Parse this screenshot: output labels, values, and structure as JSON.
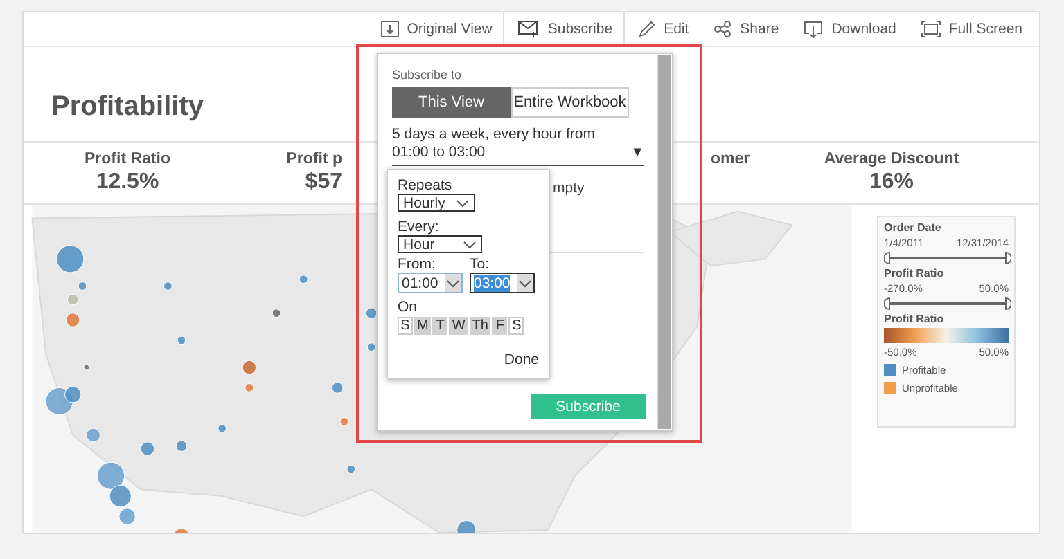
{
  "toolbar": [
    {
      "label": "Original View"
    },
    {
      "label": "Subscribe"
    },
    {
      "label": "Edit"
    },
    {
      "label": "Share"
    },
    {
      "label": "Download"
    },
    {
      "label": "Full Screen"
    }
  ],
  "title": "Profitability",
  "kpis": [
    {
      "label": "Profit Ratio",
      "value": "12.5%"
    },
    {
      "label": "Profit p",
      "value": "$57"
    },
    {
      "label": "omer"
    },
    {
      "label": "Average Discount",
      "value": "16%"
    }
  ],
  "legend": {
    "filters": [
      {
        "title": "Order Date",
        "min": "1/4/2011",
        "max": "12/31/2014",
        "level": 1
      },
      {
        "title": "Profit Ratio",
        "min": "-270.0%",
        "max": "50.0%",
        "level": 1
      }
    ],
    "scale": {
      "title": "Profit Ratio",
      "min": "-50.0%",
      "max": "50.0%"
    },
    "items": [
      {
        "label": "Profitable",
        "color": "#4f8fc2"
      },
      {
        "label": "Unprofitable",
        "color": "#f0a04c"
      }
    ]
  },
  "subscribe_dialog": {
    "heading": "Subscribe to",
    "tabs": [
      {
        "label": "This View",
        "selected": true
      },
      {
        "label": "Entire Workbook",
        "selected": false
      }
    ],
    "schedule": "5 days a week, every hour from 01:00 to 03:00",
    "dropdown_arrow": "▼",
    "partial_text": "mpty",
    "repeat_panel": {
      "repeats_label": "Repeats",
      "repeats": "Hourly",
      "every_label": "Every:",
      "every": "Hour",
      "from_label": "From:",
      "from": "01:00",
      "to_label": "To:",
      "to": "03:00",
      "on_label": "On",
      "days": [
        {
          "label": "S",
          "selected": false
        },
        {
          "label": "M",
          "selected": true
        },
        {
          "label": "T",
          "selected": true
        },
        {
          "label": "W",
          "selected": true
        },
        {
          "label": "Th",
          "selected": true
        },
        {
          "label": "F",
          "selected": true
        },
        {
          "label": "S",
          "selected": false
        }
      ],
      "done": "Done"
    },
    "subscribe_button": "Subscribe"
  }
}
